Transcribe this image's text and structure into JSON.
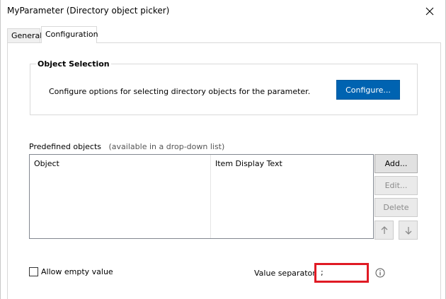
{
  "window": {
    "title": "MyParameter (Directory object picker)"
  },
  "tabs": [
    {
      "label": "General"
    },
    {
      "label": "Configuration"
    }
  ],
  "object_selection": {
    "title": "Object Selection",
    "description": "Configure options for selecting directory objects for the parameter.",
    "configure_button": "Configure..."
  },
  "predefined": {
    "label": "Predefined objects",
    "hint": "(available in a drop-down list)",
    "columns": [
      "Object",
      "Item Display Text"
    ],
    "buttons": {
      "add": "Add...",
      "edit": "Edit...",
      "delete": "Delete"
    }
  },
  "allow_empty": {
    "label": "Allow empty value",
    "checked": false
  },
  "value_separator": {
    "label": "Value separator",
    "value": ";"
  },
  "colors": {
    "accent": "#0063b1",
    "highlight": "#e01a24"
  },
  "icons": {
    "close": "close-icon",
    "up": "arrow-up-icon",
    "down": "arrow-down-icon",
    "info": "info-icon"
  }
}
